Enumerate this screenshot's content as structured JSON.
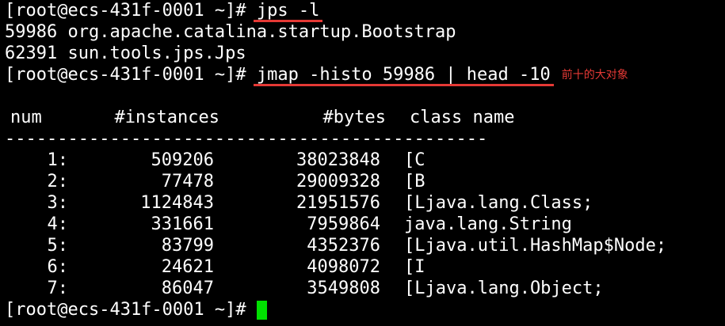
{
  "terminal": {
    "prompt": "[root@ecs-431f-0001 ~]# ",
    "cmd1": "jps -l",
    "out1": "59986 org.apache.catalina.startup.Bootstrap",
    "out2": "62391 sun.tools.jps.Jps",
    "cmd2": "jmap -histo 59986 | head -10",
    "annotation": "前十的大对象",
    "headers": {
      "num": "num",
      "instances": "#instances",
      "bytes": "#bytes",
      "class_name": "class name"
    },
    "separator": "----------------------------------------------",
    "rows": [
      {
        "num": "1:",
        "instances": "509206",
        "bytes": "38023848",
        "class_name": "[C"
      },
      {
        "num": "2:",
        "instances": "77478",
        "bytes": "29009328",
        "class_name": "[B"
      },
      {
        "num": "3:",
        "instances": "1124843",
        "bytes": "21951576",
        "class_name": "[Ljava.lang.Class;"
      },
      {
        "num": "4:",
        "instances": "331661",
        "bytes": "7959864",
        "class_name": "java.lang.String"
      },
      {
        "num": "5:",
        "instances": "83799",
        "bytes": "4352376",
        "class_name": "[Ljava.util.HashMap$Node;"
      },
      {
        "num": "6:",
        "instances": "24621",
        "bytes": "4098072",
        "class_name": "[I"
      },
      {
        "num": "7:",
        "instances": "86047",
        "bytes": "3549808",
        "class_name": "[Ljava.lang.Object;"
      }
    ],
    "colors": {
      "background": "#000000",
      "text": "#ffffff",
      "annotation": "#e53935",
      "cursor": "#00e000"
    }
  }
}
